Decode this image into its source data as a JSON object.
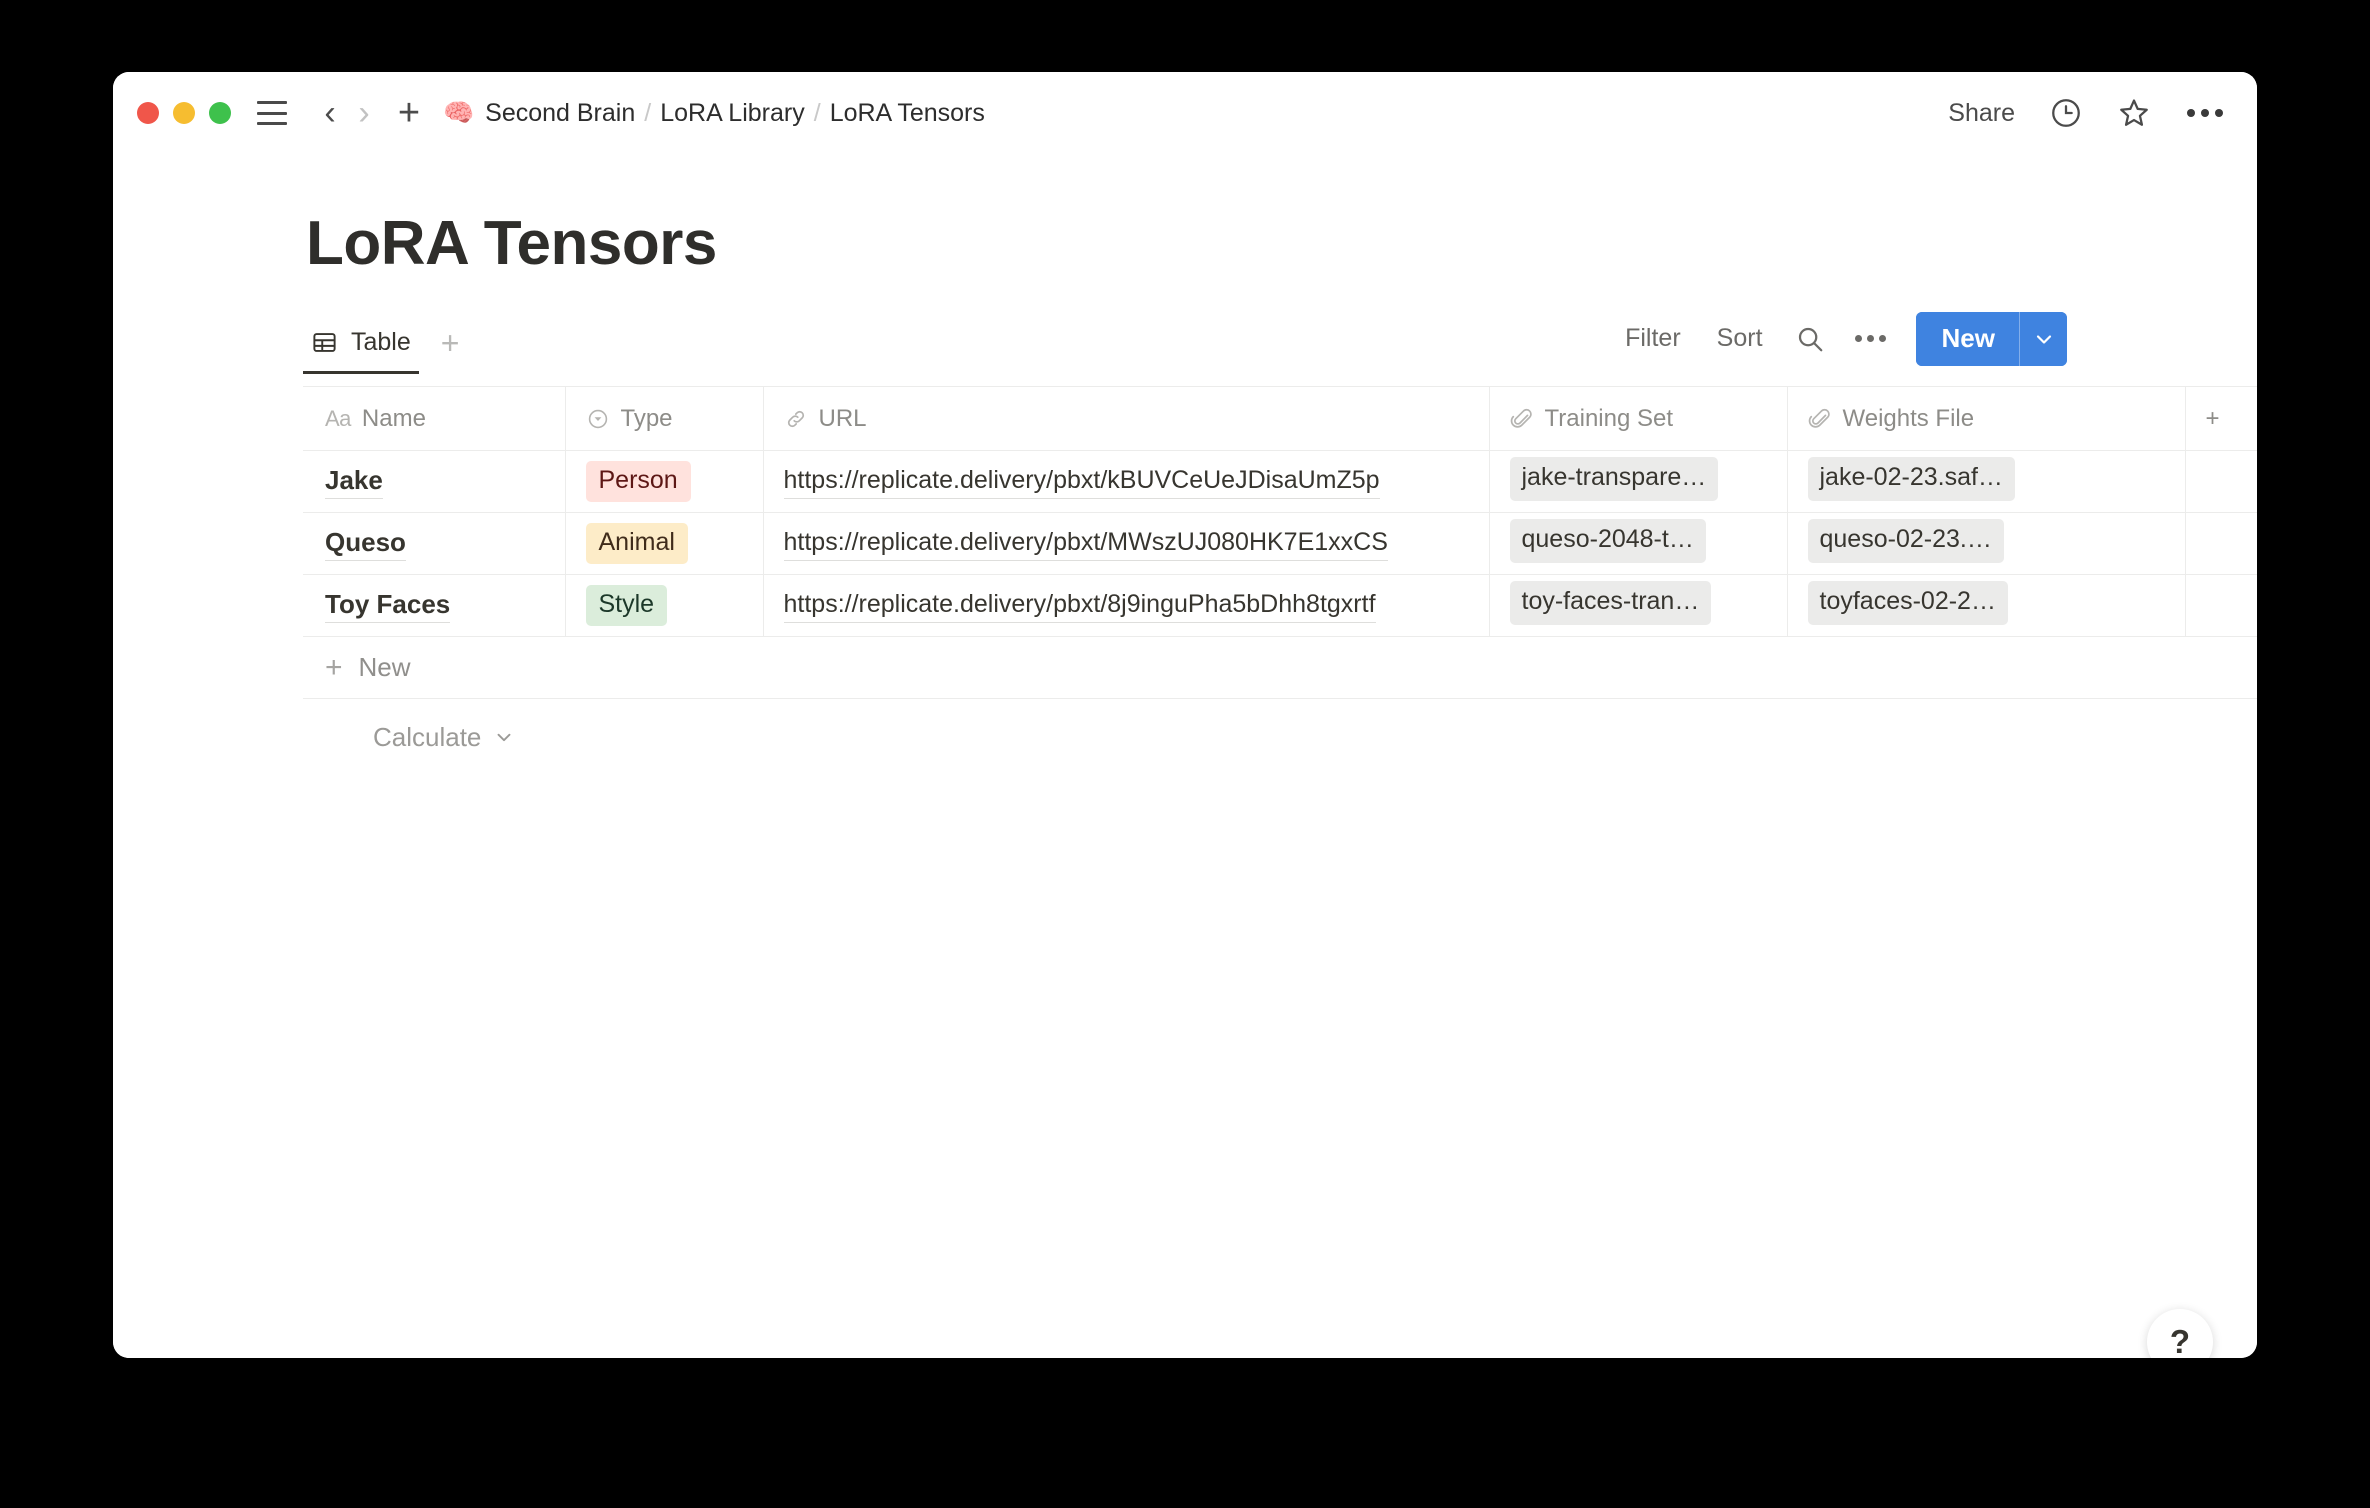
{
  "window": {
    "traffic_lights": [
      "close",
      "minimize",
      "maximize"
    ],
    "sidebar_toggle": "sidebar-toggle",
    "back": "‹",
    "forward": "›",
    "add": "+",
    "breadcrumb": {
      "icon": "🧠",
      "items": [
        "Second Brain",
        "LoRA Library",
        "LoRA Tensors"
      ],
      "separator": "/"
    },
    "share_label": "Share",
    "icons": [
      "clock-icon",
      "star-icon",
      "more-options-icon"
    ]
  },
  "page": {
    "title": "LoRA Tensors"
  },
  "view_toolbar": {
    "tabs": [
      {
        "label": "Table",
        "icon": "table-icon",
        "active": true
      }
    ],
    "add_view_label": "+",
    "filter_label": "Filter",
    "sort_label": "Sort",
    "search_icon": "search-icon",
    "more_icon": "more-options-icon",
    "new_label": "New",
    "new_caret": "⌄",
    "accent_color": "#3f83e0"
  },
  "table": {
    "columns": [
      {
        "label": "Name",
        "icon": "title-icon",
        "glyph": "Aa"
      },
      {
        "label": "Type",
        "icon": "select-icon"
      },
      {
        "label": "URL",
        "icon": "link-icon"
      },
      {
        "label": "Training Set",
        "icon": "paperclip-icon"
      },
      {
        "label": "Weights File",
        "icon": "paperclip-icon"
      },
      {
        "label": "",
        "icon": "add-column-icon",
        "glyph": "+"
      }
    ],
    "rows": [
      {
        "name": "Jake",
        "type": {
          "label": "Person",
          "color": "#ffe2dd",
          "text_color": "#5d1715"
        },
        "url": "https://replicate.delivery/pbxt/kBUVCeUeJDisaUmZ5p",
        "training_set": "jake-transpare…",
        "weights_file": "jake-02-23.saf…"
      },
      {
        "name": "Queso",
        "type": {
          "label": "Animal",
          "color": "#fdecc8",
          "text_color": "#402c1b"
        },
        "url": "https://replicate.delivery/pbxt/MWszUJ080HK7E1xxCS",
        "training_set": "queso-2048-t…",
        "weights_file": "queso-02-23.…"
      },
      {
        "name": "Toy Faces",
        "type": {
          "label": "Style",
          "color": "#dbeddb",
          "text_color": "#1c3829"
        },
        "url": "https://replicate.delivery/pbxt/8j9inguPha5bDhh8tgxrtf",
        "training_set": "toy-faces-tran…",
        "weights_file": "toyfaces-02-2…"
      }
    ],
    "new_row_label": "New",
    "new_row_plus": "+",
    "calculate_label": "Calculate",
    "calculate_caret": "⌄"
  },
  "help": {
    "label": "?"
  }
}
